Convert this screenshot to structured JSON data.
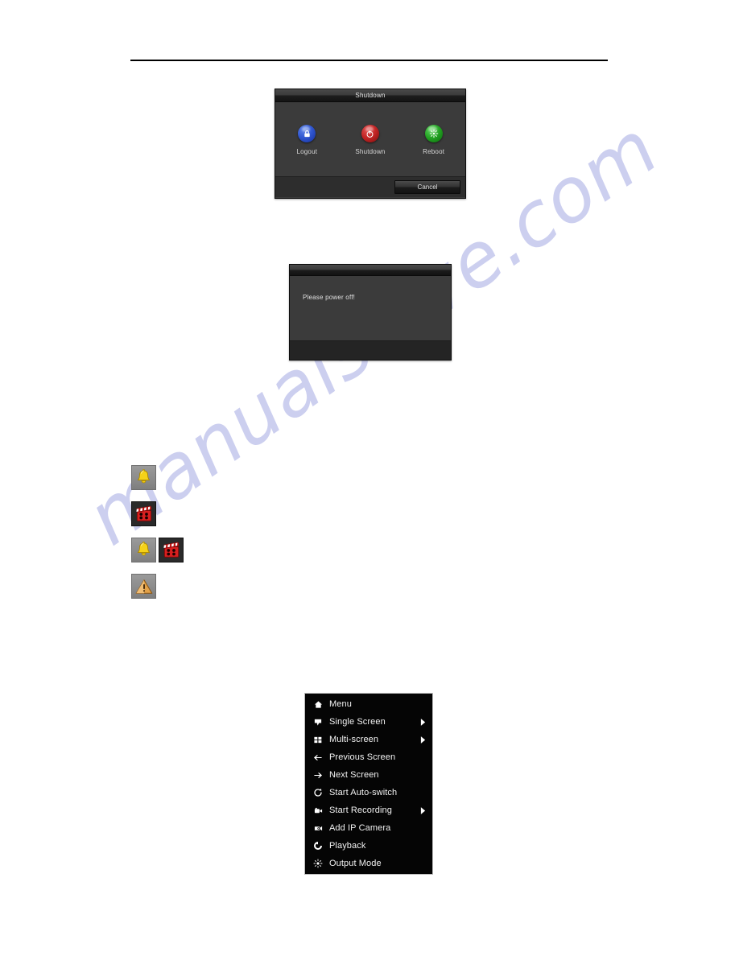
{
  "document": {
    "watermark": "manualshive.com"
  },
  "shutdown_dialog": {
    "title": "Shutdown",
    "options": [
      {
        "label": "Logout",
        "icon": "lock-orb-icon",
        "color": "#2f55cf"
      },
      {
        "label": "Shutdown",
        "icon": "power-orb-icon",
        "color": "#c22424"
      },
      {
        "label": "Reboot",
        "icon": "reboot-orb-icon",
        "color": "#22a322"
      }
    ],
    "cancel_label": "Cancel"
  },
  "poweroff_dialog": {
    "message": "Please power off!"
  },
  "status_icons": [
    {
      "name": "alarm-bell-icon",
      "glyphs": [
        "bell"
      ]
    },
    {
      "name": "recording-icon",
      "glyphs": [
        "film"
      ]
    },
    {
      "name": "alarm-and-recording-icon",
      "glyphs": [
        "bell",
        "film"
      ]
    },
    {
      "name": "exception-warning-icon",
      "glyphs": [
        "warning"
      ]
    }
  ],
  "context_menu": {
    "items": [
      {
        "label": "Menu",
        "icon": "home-icon",
        "submenu": false
      },
      {
        "label": "Single Screen",
        "icon": "single-screen-icon",
        "submenu": true
      },
      {
        "label": "Multi-screen",
        "icon": "multi-screen-icon",
        "submenu": true
      },
      {
        "label": "Previous Screen",
        "icon": "arrow-left-icon",
        "submenu": false
      },
      {
        "label": "Next Screen",
        "icon": "arrow-right-icon",
        "submenu": false
      },
      {
        "label": "Start Auto-switch",
        "icon": "auto-switch-icon",
        "submenu": false
      },
      {
        "label": "Start Recording",
        "icon": "record-camera-icon",
        "submenu": true
      },
      {
        "label": "Add IP Camera",
        "icon": "ip-camera-icon",
        "submenu": false
      },
      {
        "label": "Playback",
        "icon": "playback-icon",
        "submenu": false
      },
      {
        "label": "Output Mode",
        "icon": "output-mode-icon",
        "submenu": false
      }
    ]
  }
}
